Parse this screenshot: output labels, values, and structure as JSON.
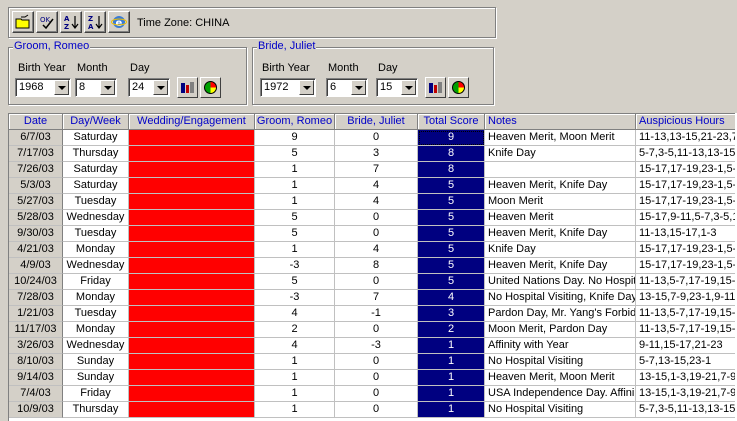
{
  "toolbar": {
    "buttons": [
      {
        "name": "open-folder-icon"
      },
      {
        "name": "check-list-icon"
      },
      {
        "name": "sort-ascending-icon",
        "label": "AZ"
      },
      {
        "name": "sort-descending-icon",
        "label": "ZA"
      },
      {
        "name": "internet-explorer-icon"
      }
    ],
    "timezone_label": "Time Zone:",
    "timezone_value": "CHINA"
  },
  "groom": {
    "title": "Groom, Romeo",
    "birth_year_label": "Birth Year",
    "month_label": "Month",
    "day_label": "Day",
    "birth_year": "1968",
    "month": "8",
    "day": "24"
  },
  "bride": {
    "title": "Bride, Juliet",
    "birth_year_label": "Birth Year",
    "month_label": "Month",
    "day_label": "Day",
    "birth_year": "1972",
    "month": "6",
    "day": "15"
  },
  "colors": {
    "red": "#ff0000",
    "navy": "#000080",
    "header_text": "#0000c8"
  },
  "table": {
    "columns": [
      "Date",
      "Day/Week",
      "Wedding/Engagement",
      "Groom, Romeo",
      "Bride, Juliet",
      "Total Score",
      "Notes",
      "Auspicious Hours"
    ],
    "rows": [
      [
        "6/7/03",
        "Saturday",
        "",
        "9",
        "0",
        "9",
        "Heaven Merit, Moon Merit",
        "11-13,13-15,21-23,7-"
      ],
      [
        "7/17/03",
        "Thursday",
        "",
        "5",
        "3",
        "8",
        "Knife Day",
        "5-7,3-5,11-13,13-15,2"
      ],
      [
        "7/26/03",
        "Saturday",
        "",
        "1",
        "7",
        "8",
        "",
        "15-17,17-19,23-1,5-7"
      ],
      [
        "5/3/03",
        "Saturday",
        "",
        "1",
        "4",
        "5",
        "Heaven Merit, Knife Day",
        "15-17,17-19,23-1,5-7"
      ],
      [
        "5/27/03",
        "Tuesday",
        "",
        "1",
        "4",
        "5",
        "Moon Merit",
        "15-17,17-19,23-1,5-7"
      ],
      [
        "5/28/03",
        "Wednesday",
        "",
        "5",
        "0",
        "5",
        "Heaven Merit",
        "15-17,9-11,5-7,3-5,15"
      ],
      [
        "9/30/03",
        "Tuesday",
        "",
        "5",
        "0",
        "5",
        "Heaven Merit, Knife Day",
        "11-13,15-17,1-3"
      ],
      [
        "4/21/03",
        "Monday",
        "",
        "1",
        "4",
        "5",
        "Knife Day",
        "15-17,17-19,23-1,5-7"
      ],
      [
        "4/9/03",
        "Wednesday",
        "",
        "-3",
        "8",
        "5",
        "Heaven Merit, Knife Day",
        "15-17,17-19,23-1,5-7"
      ],
      [
        "10/24/03",
        "Friday",
        "",
        "5",
        "0",
        "5",
        "United Nations Day. No Hospit",
        "11-13,5-7,17-19,15-1"
      ],
      [
        "7/28/03",
        "Monday",
        "",
        "-3",
        "7",
        "4",
        "No Hospital Visiting, Knife Day",
        "13-15,7-9,23-1,9-11"
      ],
      [
        "1/21/03",
        "Tuesday",
        "",
        "4",
        "-1",
        "3",
        "Pardon Day, Mr. Yang's Forbid",
        "11-13,5-7,17-19,15-1"
      ],
      [
        "11/17/03",
        "Monday",
        "",
        "2",
        "0",
        "2",
        "Moon Merit, Pardon Day",
        "11-13,5-7,17-19,15-1"
      ],
      [
        "3/26/03",
        "Wednesday",
        "",
        "4",
        "-3",
        "1",
        "Affinity with Year",
        "9-11,15-17,21-23"
      ],
      [
        "8/10/03",
        "Sunday",
        "",
        "1",
        "0",
        "1",
        "No Hospital Visiting",
        "5-7,13-15,23-1"
      ],
      [
        "9/14/03",
        "Sunday",
        "",
        "1",
        "0",
        "1",
        "Heaven Merit, Moon Merit",
        "13-15,1-3,19-21,7-9,"
      ],
      [
        "7/4/03",
        "Friday",
        "",
        "1",
        "0",
        "1",
        "USA Independence Day. Affini",
        "13-15,1-3,19-21,7-9"
      ],
      [
        "10/9/03",
        "Thursday",
        "",
        "1",
        "0",
        "1",
        "No Hospital Visiting",
        "5-7,3-5,11-13,13-15,2"
      ]
    ]
  }
}
